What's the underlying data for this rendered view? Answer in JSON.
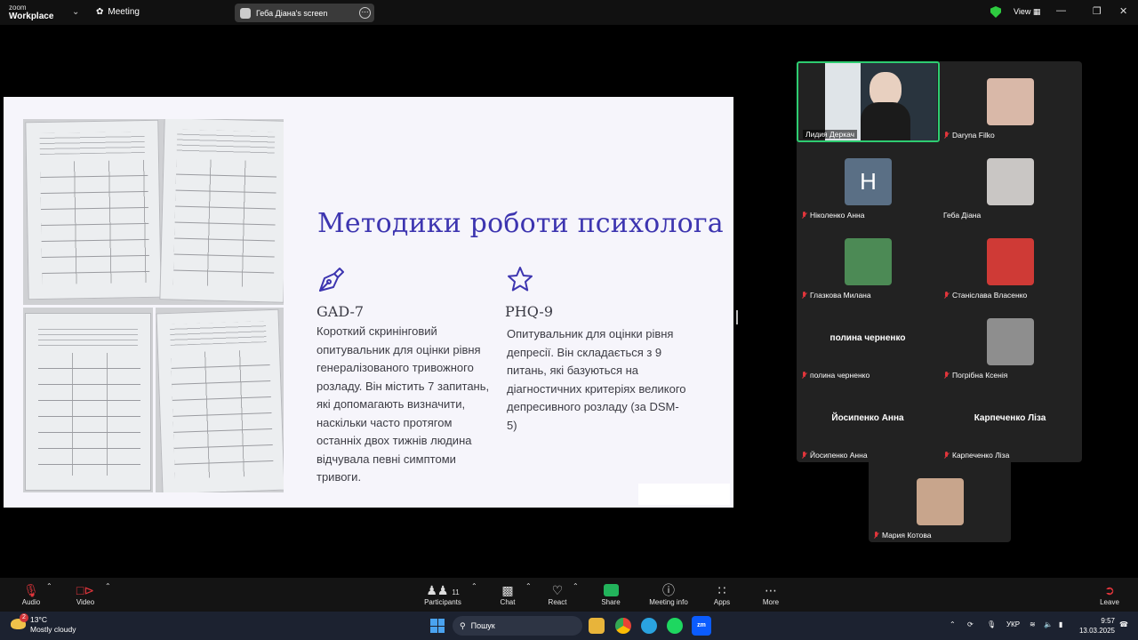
{
  "app": {
    "brand_line1": "zoom",
    "brand_line2": "Workplace",
    "meeting_label": "Meeting",
    "screen_share_label": "Геба Діана's screen",
    "view_label": "View"
  },
  "slide": {
    "title": "Методики роботи психолога",
    "left": {
      "icon": "pen-icon",
      "heading": "GAD-7",
      "text": "Короткий скринінговий опитувальник для оцінки рівня генералізованого тривожного розладу. Він містить 7 запитань, які допомагають визначити, наскільки часто протягом останніх двох тижнів людина відчувала певні симптоми тривоги."
    },
    "right": {
      "icon": "star-icon",
      "heading": "PHQ-9",
      "text": "Опитувальник для оцінки рівня депресії. Він складається з 9 питань, які базуються на діагностичних критеріях великого депресивного розладу (за DSM-5)"
    },
    "accent_color": "#3d35b0"
  },
  "participants": [
    {
      "name": "Лидия Деркач",
      "muted": false,
      "kind": "video",
      "active": true
    },
    {
      "name": "Daryna Filko",
      "muted": true,
      "kind": "photo",
      "color": "#d9b8a8"
    },
    {
      "name": "Ніколенко Анна",
      "muted": true,
      "kind": "avatar",
      "initial": "Н",
      "color": "#5a6f85"
    },
    {
      "name": "Геба Діана",
      "muted": false,
      "kind": "photo",
      "color": "#c9c6c4"
    },
    {
      "name": "Глазкова Милана",
      "muted": true,
      "kind": "photo",
      "color": "#4c8a55"
    },
    {
      "name": "Станіслава Власенко",
      "muted": true,
      "kind": "photo",
      "color": "#cf3a36"
    },
    {
      "name": "полина черненко",
      "muted": true,
      "kind": "name",
      "display": "полина черненко"
    },
    {
      "name": "Погрібна Ксенія",
      "muted": true,
      "kind": "photo",
      "color": "#8e8e8e"
    },
    {
      "name": "Йосипенко Анна",
      "muted": true,
      "kind": "name",
      "display": "Йосипенко Анна"
    },
    {
      "name": "Карпеченко Ліза",
      "muted": true,
      "kind": "name",
      "display": "Карпеченко Ліза"
    },
    {
      "name": "Мария Котова",
      "muted": true,
      "kind": "photo",
      "color": "#c8a58c"
    }
  ],
  "toolbar": {
    "audio": "Audio",
    "video": "Video",
    "participants": "Participants",
    "participants_count": "11",
    "chat": "Chat",
    "react": "React",
    "share": "Share",
    "meeting_info": "Meeting info",
    "apps": "Apps",
    "more": "More",
    "leave": "Leave"
  },
  "taskbar": {
    "temperature": "13°C",
    "weather": "Mostly cloudy",
    "weather_badge": "2",
    "search_placeholder": "Пошук",
    "language": "УКР",
    "time": "9:57",
    "date": "13.03.2025"
  }
}
